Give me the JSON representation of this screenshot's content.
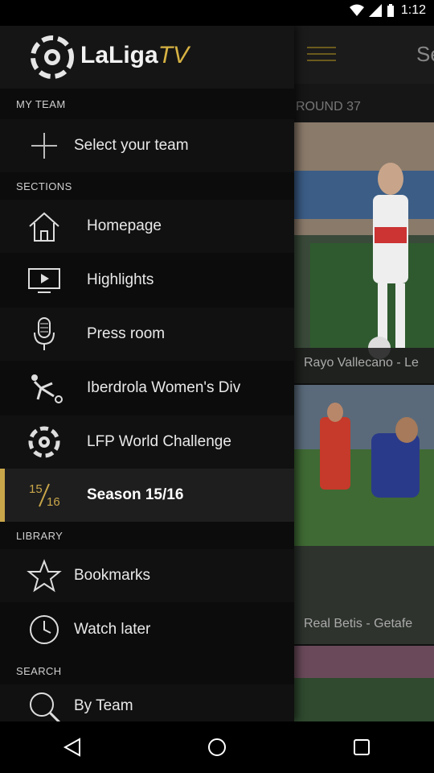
{
  "status": {
    "time": "1:12"
  },
  "brand": {
    "name": "LaLiga",
    "suffix": "TV"
  },
  "background": {
    "title_partial": "Se",
    "round_label": "ROUND 37",
    "cards": [
      {
        "label": "Rayo Vallecano - Le"
      },
      {
        "label": "Real Betis - Getafe"
      }
    ]
  },
  "drawer": {
    "my_team": {
      "title": "MY TEAM",
      "select_label": "Select your team"
    },
    "sections": {
      "title": "SECTIONS",
      "items": [
        {
          "label": "Homepage",
          "icon": "home-icon"
        },
        {
          "label": "Highlights",
          "icon": "tv-play-icon"
        },
        {
          "label": "Press room",
          "icon": "microphone-icon"
        },
        {
          "label": "Iberdrola Women's Div",
          "icon": "player-kick-icon"
        },
        {
          "label": "LFP World Challenge",
          "icon": "laliga-logo-icon"
        },
        {
          "label": "Season 15/16",
          "icon": "season-icon",
          "selected": true,
          "icon_text_top": "15",
          "icon_text_bottom": "16"
        }
      ]
    },
    "library": {
      "title": "LIBRARY",
      "items": [
        {
          "label": "Bookmarks",
          "icon": "star-icon"
        },
        {
          "label": "Watch later",
          "icon": "clock-icon"
        }
      ]
    },
    "search": {
      "title": "SEARCH",
      "items": [
        {
          "label": "By Team",
          "icon": "search-icon"
        }
      ]
    }
  },
  "colors": {
    "accent": "#c9a64a",
    "drawer_bg": "#0c0c0c"
  }
}
